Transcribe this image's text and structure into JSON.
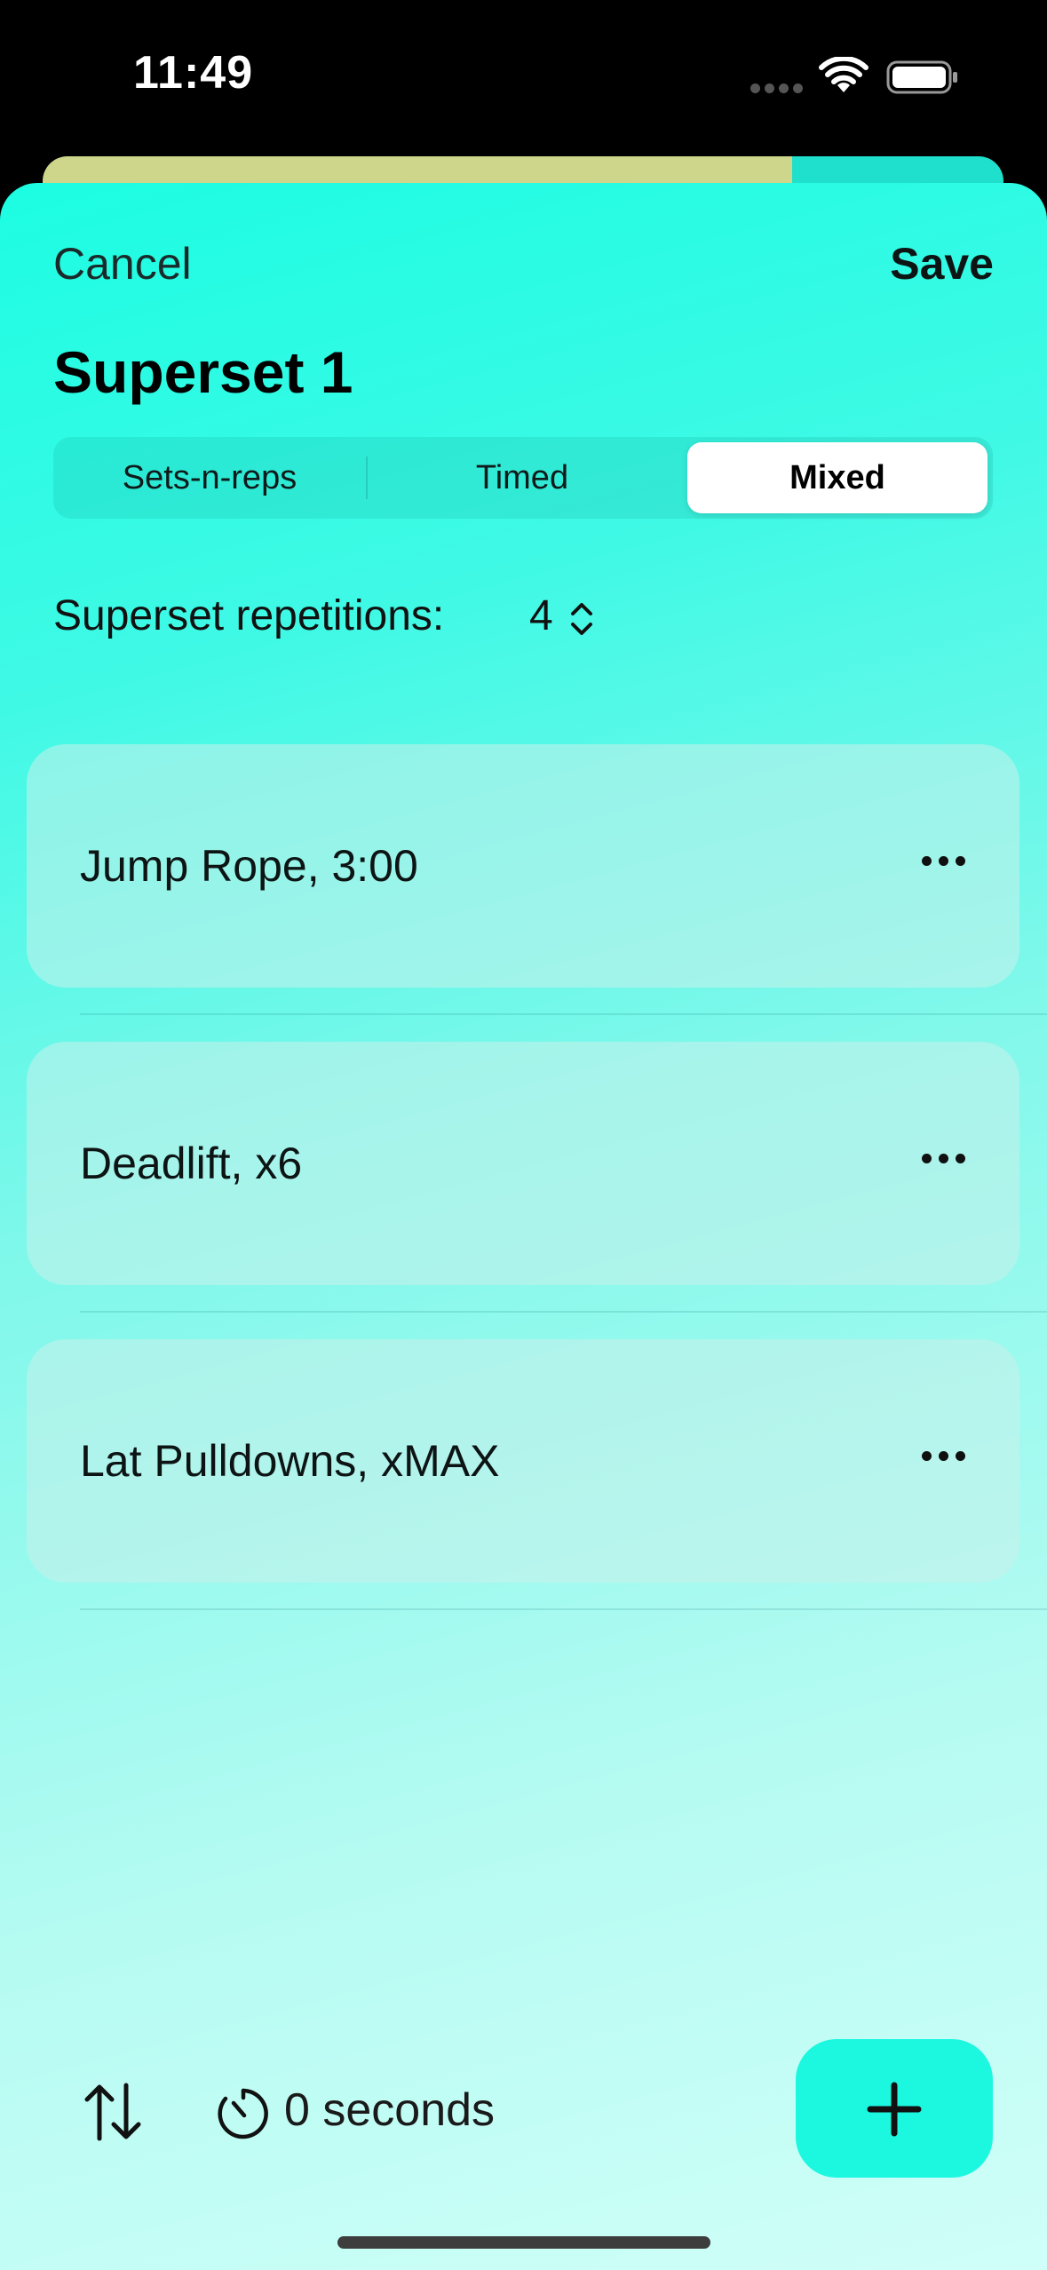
{
  "status_bar": {
    "time": "11:49"
  },
  "nav": {
    "cancel_label": "Cancel",
    "save_label": "Save"
  },
  "title": "Superset 1",
  "segmented_control": {
    "options": [
      "Sets-n-reps",
      "Timed",
      "Mixed"
    ],
    "selected": "Mixed"
  },
  "repetitions": {
    "label": "Superset repetitions:",
    "value": "4"
  },
  "exercises": [
    {
      "label": "Jump Rope,  3:00"
    },
    {
      "label": "Deadlift,  x6"
    },
    {
      "label": "Lat Pulldowns,  xMAX"
    }
  ],
  "footer": {
    "rest_label": "0 seconds"
  },
  "colors": {
    "accent": "#1cf8e0",
    "sheet_top": "#1cfde2",
    "sheet_bottom": "#cffff8"
  }
}
